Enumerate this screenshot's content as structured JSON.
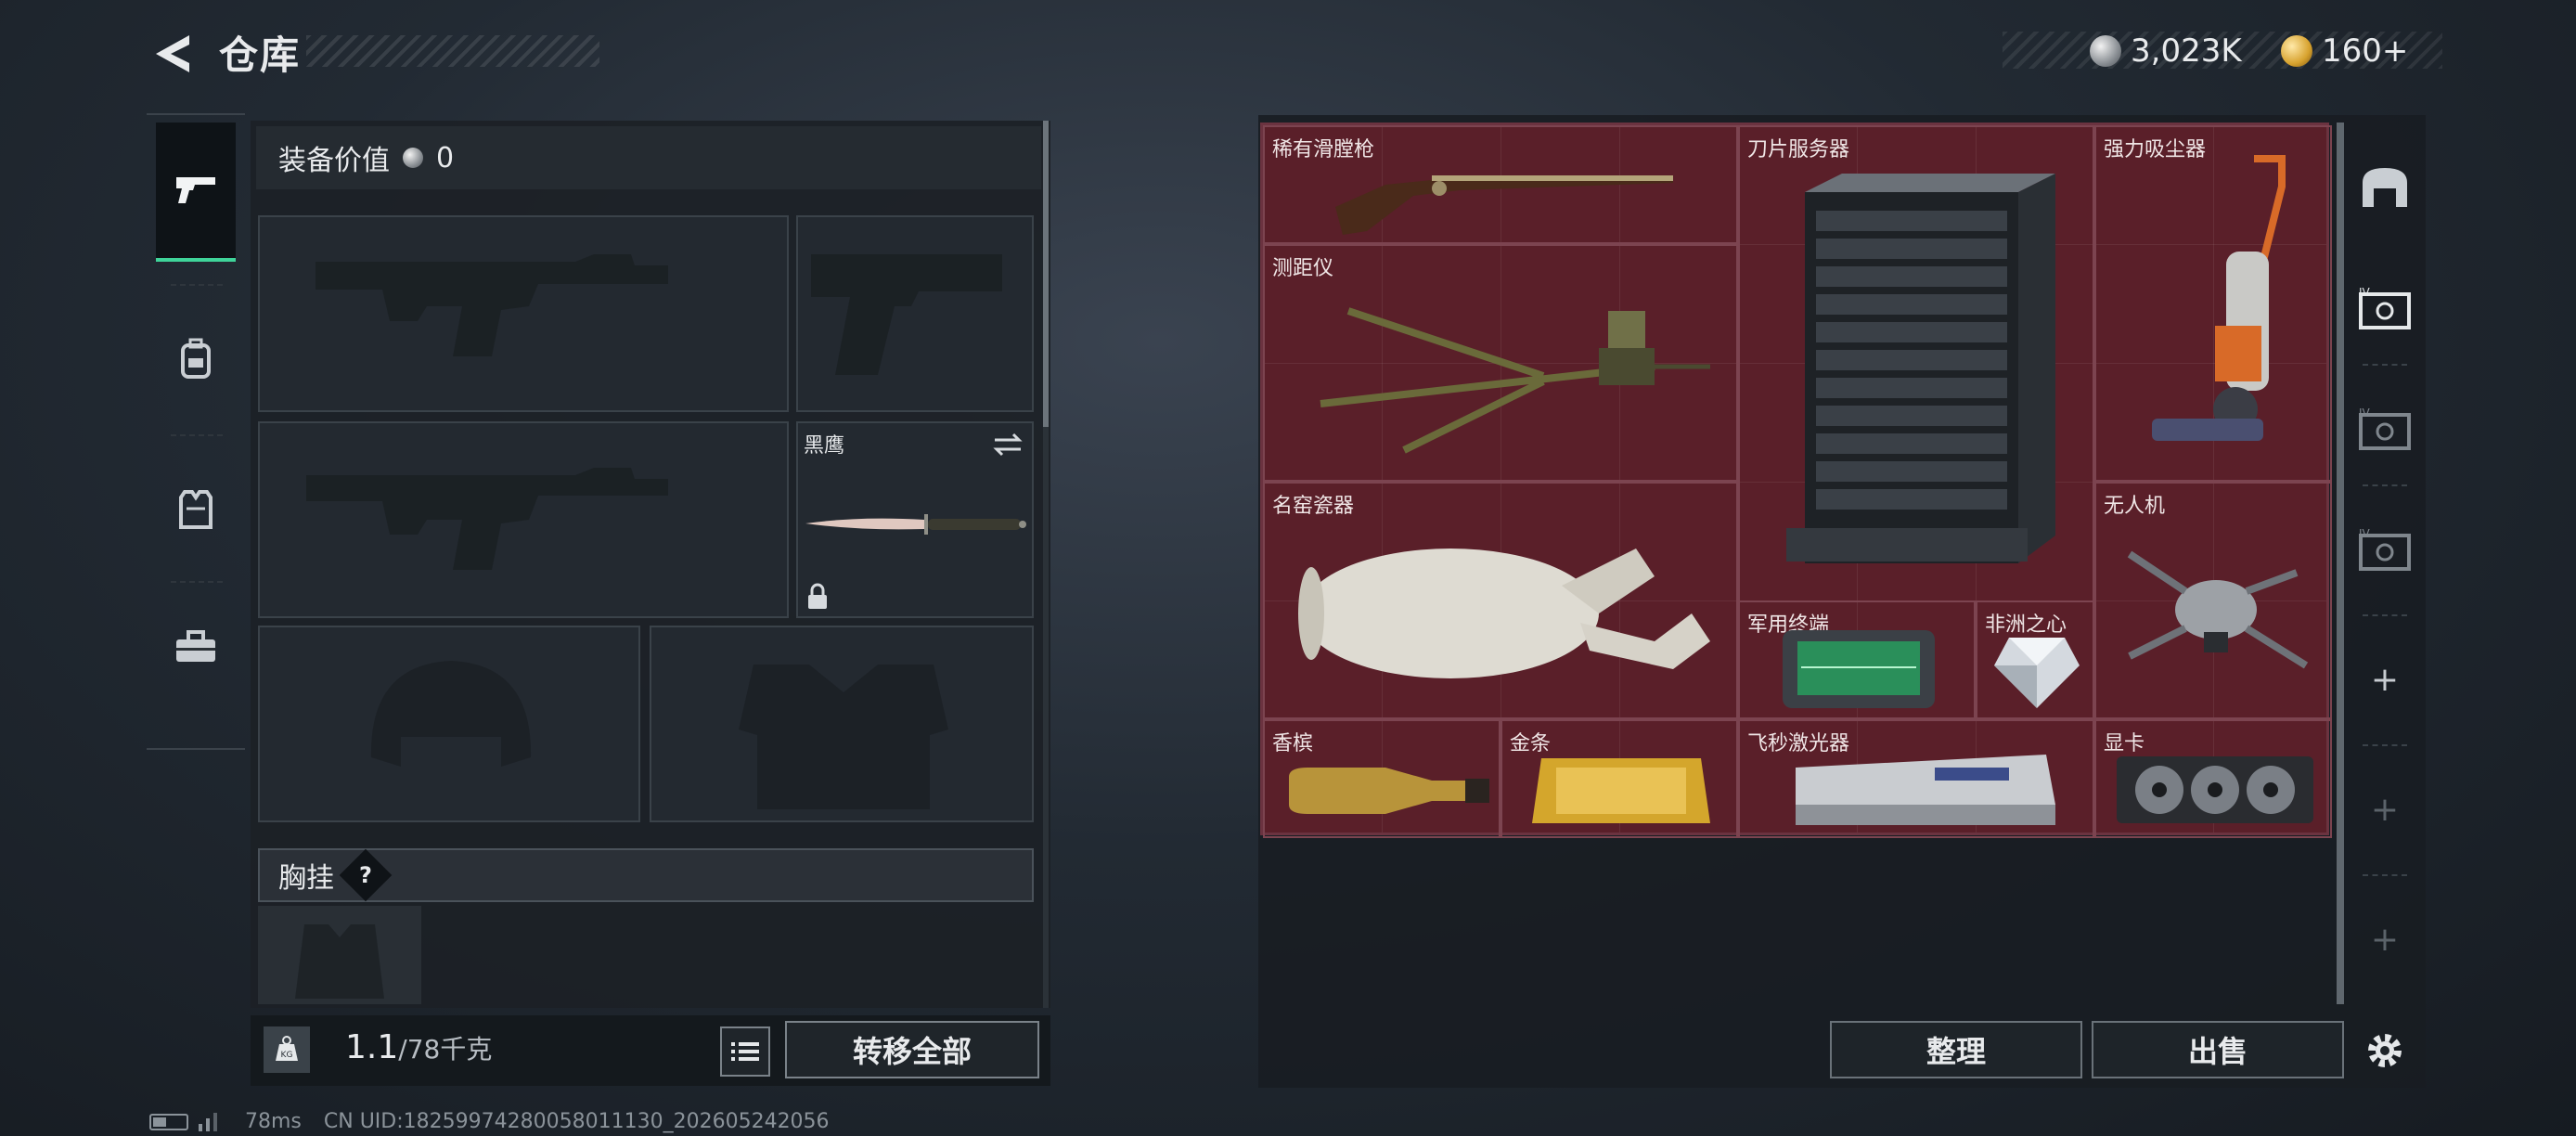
{
  "header": {
    "title": "仓库",
    "currencies": [
      {
        "icon": "silver-coin-icon",
        "value": "3,023K"
      },
      {
        "icon": "gold-coin-icon",
        "value": "160+"
      }
    ]
  },
  "side_nav": {
    "items": [
      {
        "icon": "pistol-icon",
        "active": true
      },
      {
        "icon": "backpack-icon",
        "active": false
      },
      {
        "icon": "vest-icon",
        "active": false
      },
      {
        "icon": "toolbox-icon",
        "active": false
      }
    ]
  },
  "loadout": {
    "value_label": "装备价值",
    "value_amount": "0",
    "melee_label": "黑鹰",
    "chest_label": "胸挂",
    "chest_help": "?",
    "weight_value": "1.1",
    "weight_capacity": "/78千克",
    "transfer_label": "转移全部"
  },
  "stash": {
    "items": [
      {
        "label": "稀有滑膛枪"
      },
      {
        "label": "刀片服务器"
      },
      {
        "label": "强力吸尘器"
      },
      {
        "label": "测距仪"
      },
      {
        "label": "名窑瓷器"
      },
      {
        "label": "无人机"
      },
      {
        "label": "军用终端"
      },
      {
        "label": "非洲之心"
      },
      {
        "label": "香槟"
      },
      {
        "label": "金条"
      },
      {
        "label": "飞秒激光器"
      },
      {
        "label": "显卡"
      }
    ],
    "sort_label": "整理",
    "sell_label": "出售"
  },
  "footer": {
    "ping": "78ms",
    "uid": "CN UID:18259974280058011130_202605242056"
  },
  "colors": {
    "accent": "#3fd49a",
    "stash_bg": "#5a1f29"
  }
}
